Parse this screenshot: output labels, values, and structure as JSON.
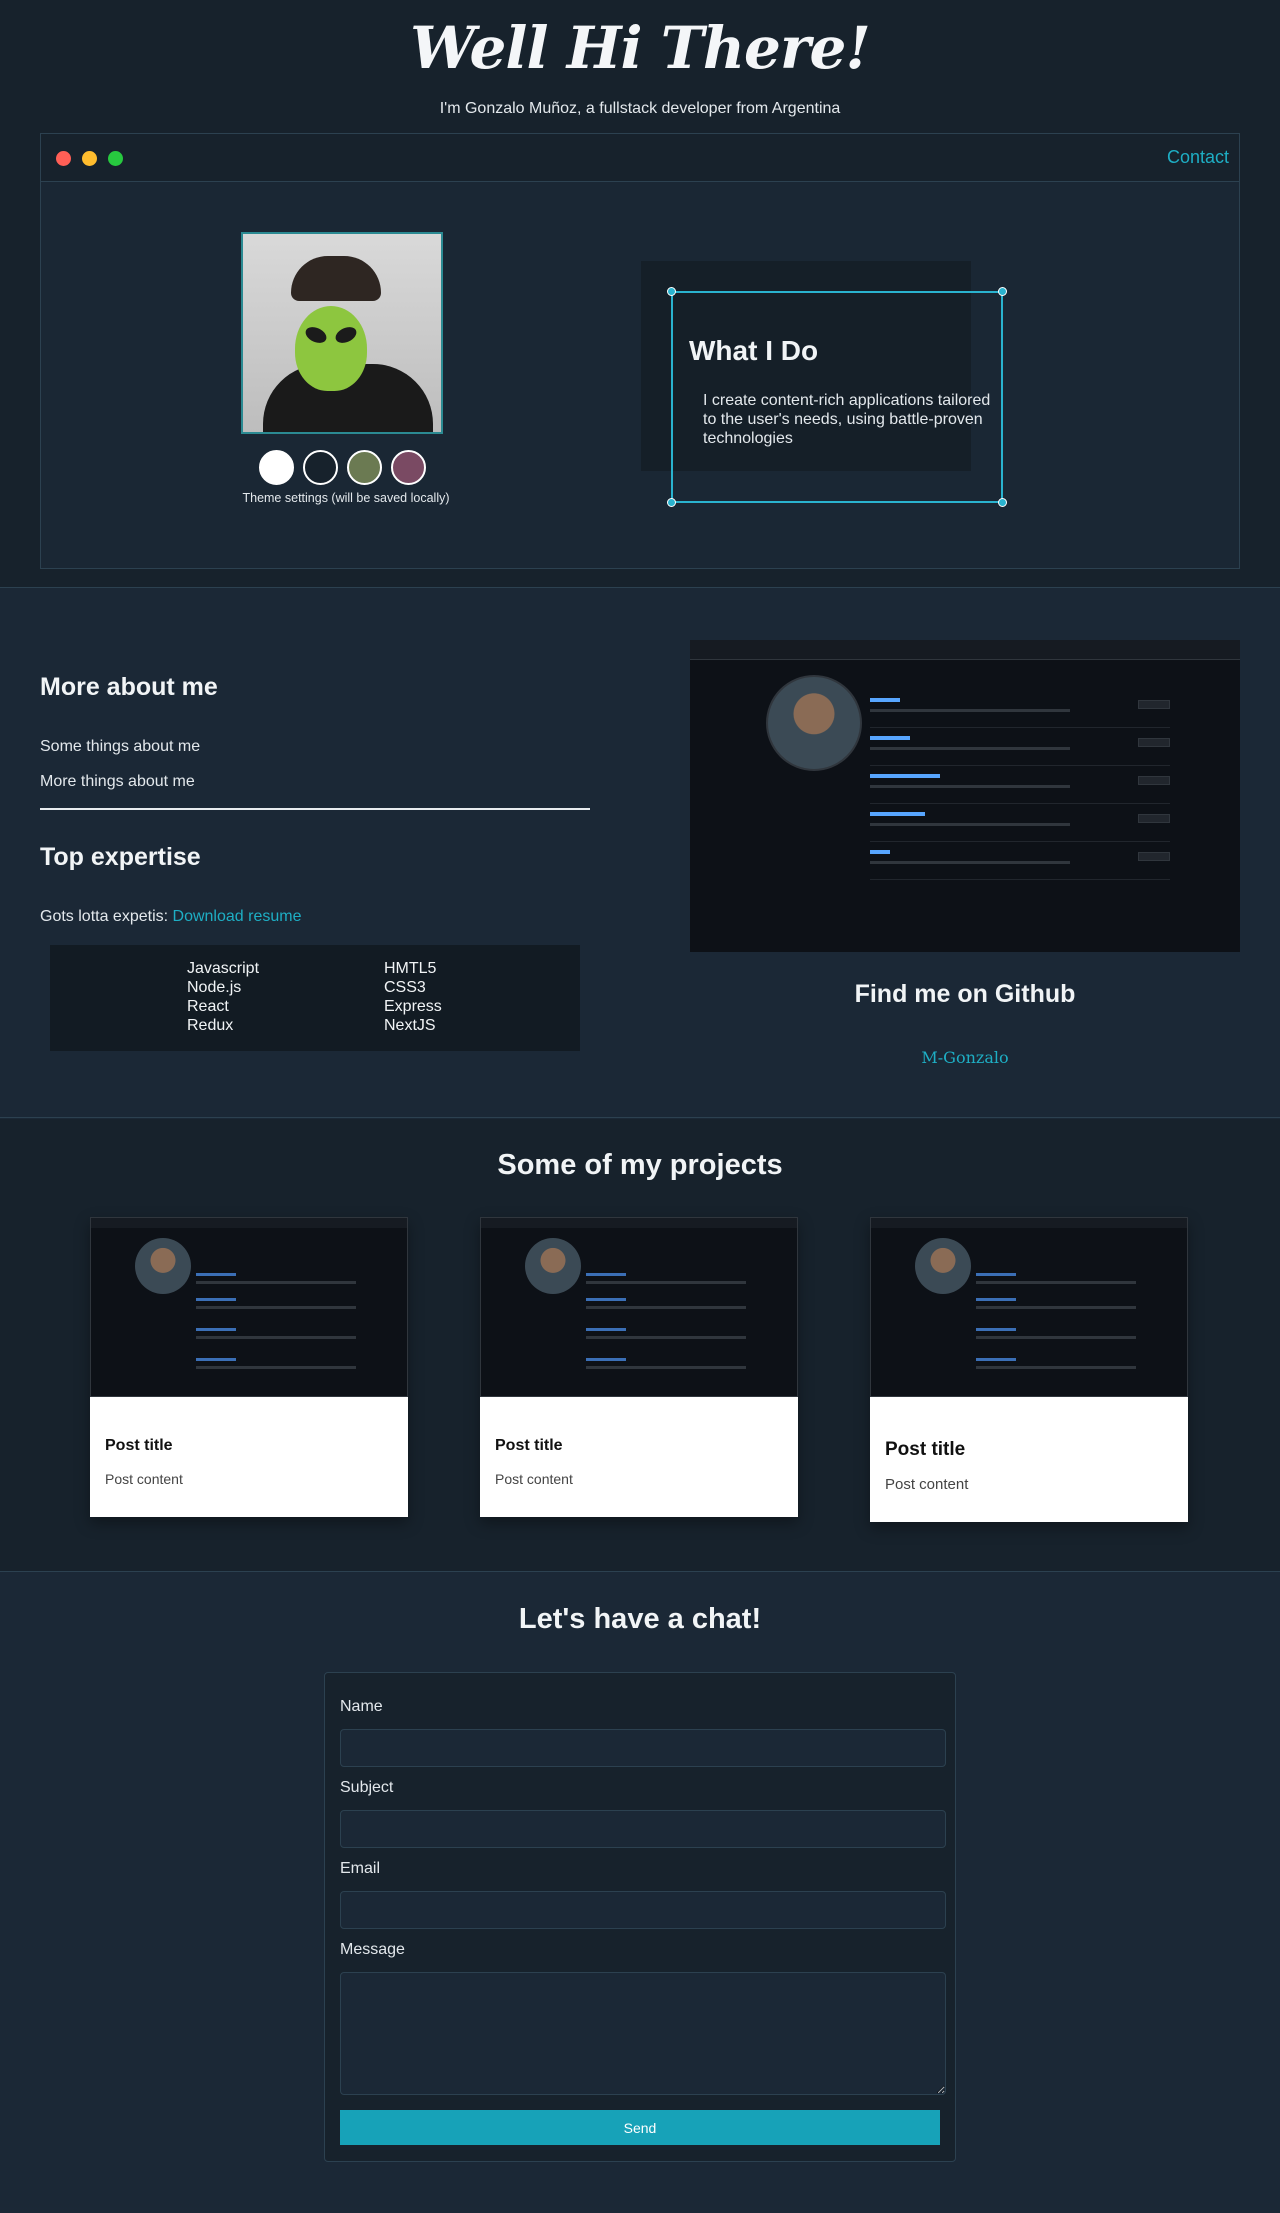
{
  "hero": {
    "title": "Well Hi There!",
    "subtitle": "I'm Gonzalo Muñoz, a fullstack developer from Argentina",
    "contact_label": "Contact",
    "theme_label": "Theme settings (will be saved locally)",
    "swatches": [
      "#ffffff",
      "#17222c",
      "#6b7a52",
      "#7a4a63"
    ],
    "what_title": "What I Do",
    "what_text": "I create content-rich applications tailored to the user's needs, using battle-proven technologies"
  },
  "about": {
    "title": "More about me",
    "line1": "Some things about me",
    "line2": "More things about me",
    "expertise_title": "Top expertise",
    "resume_prefix": "Gots lotta expetis:",
    "resume_link": "Download resume",
    "skills_col1": [
      "Javascript",
      "Node.js",
      "React",
      "Redux"
    ],
    "skills_col2": [
      "HMTL5",
      "CSS3",
      "Express",
      "NextJS"
    ]
  },
  "github": {
    "title": "Find me on Github",
    "username": "M-Gonzalo"
  },
  "projects": {
    "title": "Some of my projects",
    "cards": [
      {
        "title": "Post title",
        "content": "Post content"
      },
      {
        "title": "Post title",
        "content": "Post content"
      },
      {
        "title": "Post title",
        "content": "Post content"
      }
    ]
  },
  "chat": {
    "title": "Let's have a chat!",
    "name_label": "Name",
    "subject_label": "Subject",
    "email_label": "Email",
    "message_label": "Message",
    "send_label": "Send"
  },
  "colors": {
    "accent": "#1eaec4",
    "button": "#17a2b8",
    "background": "#1b2836"
  }
}
